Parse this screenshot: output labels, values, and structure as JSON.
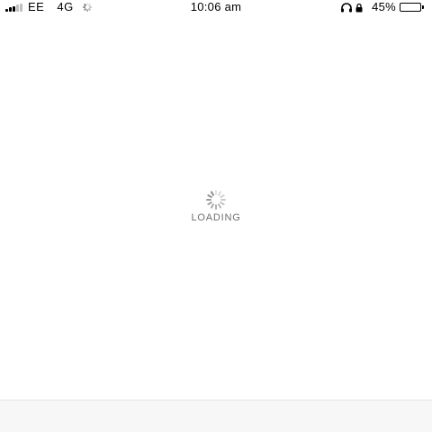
{
  "status_bar": {
    "carrier": "EE",
    "network": "4G",
    "time": "10:06 am",
    "battery_percent_text": "45%",
    "battery_level": 0.45,
    "signal_bars_active": 3,
    "signal_bars_total": 5,
    "icons": [
      "signal-icon",
      "activity-spinner-icon",
      "headphones-icon",
      "orientation-lock-icon",
      "battery-icon"
    ]
  },
  "main": {
    "loading_label": "LOADING",
    "spinner_icon": "loading-spinner-icon"
  },
  "colors": {
    "background": "#ffffff",
    "loading_text": "#6e6e6e",
    "spinner": "#8a8a8a",
    "bottom_bar": "#f7f7f7"
  }
}
